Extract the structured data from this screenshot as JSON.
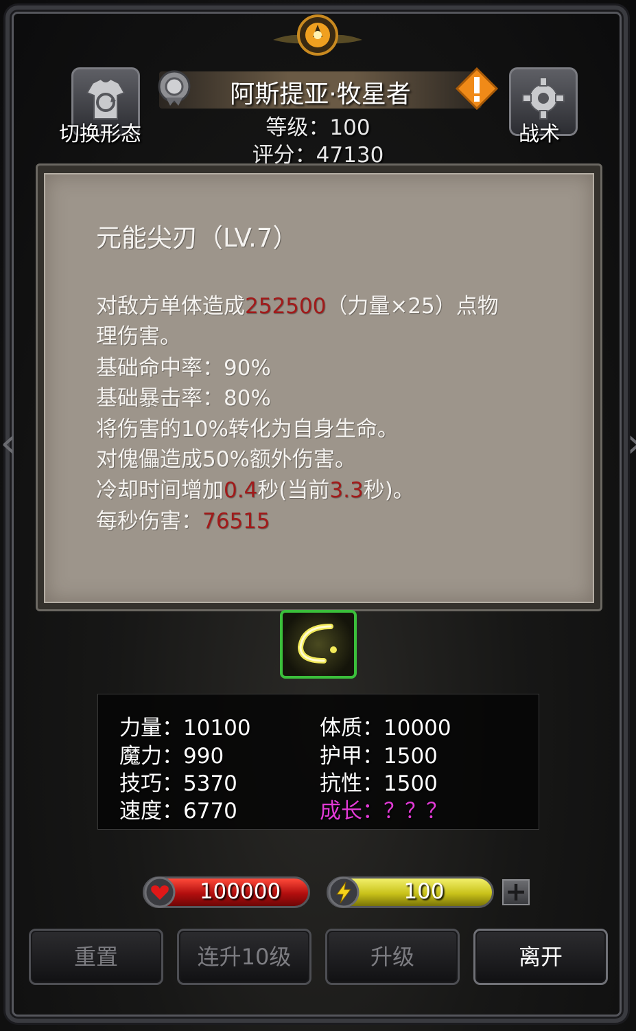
{
  "header": {
    "switch_form_label": "切换形态",
    "tactics_label": "战术",
    "hero_name": "阿斯提亚·牧星者",
    "level_text": "等级：100",
    "score_text": "评分：47130"
  },
  "skill_tooltip": {
    "title": "元能尖刃（LV.7）",
    "line1_prefix": "对敌方单体造成",
    "line1_damage": "252500",
    "line1_suffix": "（力量×25）点物",
    "line1_cont": "理伤害。",
    "hit_rate": "基础命中率：90%",
    "crit_rate": "基础暴击率：80%",
    "lifesteal": "将伤害的10%转化为自身生命。",
    "puppet_bonus": "对傀儡造成50%额外伤害。",
    "cooldown_prefix": "冷却时间增加",
    "cooldown_add": "0.4",
    "cooldown_mid": "秒(当前",
    "cooldown_current": "3.3",
    "cooldown_suffix": "秒)。",
    "dps_label": "每秒伤害：",
    "dps_value": "76515"
  },
  "attributes": {
    "strength": "力量：10100",
    "constitution": "体质：10000",
    "magic": "魔力：990",
    "armor": "护甲：1500",
    "skill": "技巧：5370",
    "resistance": "抗性：1500",
    "speed": "速度：6770",
    "growth": "成长：？？？"
  },
  "bars": {
    "hp_value": "100000",
    "energy_value": "100",
    "plus_label": "+"
  },
  "buttons": {
    "reset": "重置",
    "level_up_10": "连升10级",
    "level_up": "升级",
    "leave": "离开"
  },
  "colors": {
    "highlight_red": "#a11a1a",
    "growth_magenta": "#e23ad6",
    "skill_border_green": "#3bbf3b"
  }
}
